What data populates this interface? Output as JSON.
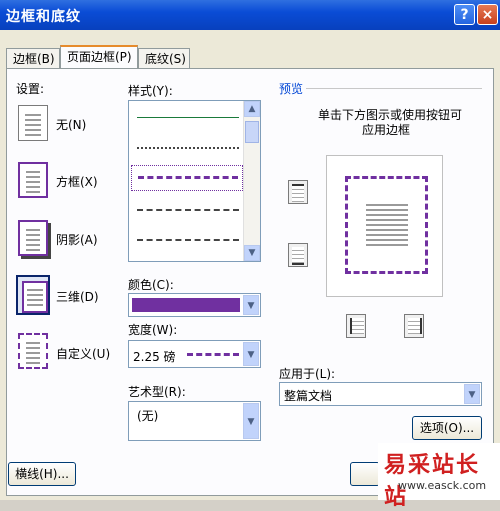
{
  "window": {
    "title": "边框和底纹",
    "help_label": "?",
    "close_label": "×"
  },
  "tabs": [
    {
      "label": "边框(B)",
      "active": false
    },
    {
      "label": "页面边框(P)",
      "active": true
    },
    {
      "label": "底纹(S)",
      "active": false
    }
  ],
  "settings": {
    "header": "设置:",
    "items": [
      {
        "label": "无(N)"
      },
      {
        "label": "方框(X)"
      },
      {
        "label": "阴影(A)"
      },
      {
        "label": "三维(D)",
        "selected": true
      },
      {
        "label": "自定义(U)"
      }
    ]
  },
  "style": {
    "header": "样式(Y):",
    "up_arrow": "▲",
    "down_arrow": "▼",
    "selected_index": 2
  },
  "color": {
    "label": "颜色(C):",
    "value_color": "#7030a0",
    "arrow": "▼"
  },
  "width": {
    "label": "宽度(W):",
    "value": "2.25 磅",
    "arrow": "▼"
  },
  "art": {
    "label": "艺术型(R):",
    "value": "(无)",
    "arrow": "▼"
  },
  "preview": {
    "header": "预览",
    "instruction_line1": "单击下方图示或使用按钮可",
    "instruction_line2": "应用边框"
  },
  "apply_to": {
    "label": "应用于(L):",
    "value": "整篇文档",
    "arrow": "▼"
  },
  "buttons": {
    "options": "选项(O)...",
    "horizontal_line": "横线(H)..."
  },
  "watermark": {
    "text": "易采站长站",
    "url": "www.easck.com"
  },
  "colors": {
    "accent": "#7030a0",
    "title_bar": "#0a4cd6"
  }
}
